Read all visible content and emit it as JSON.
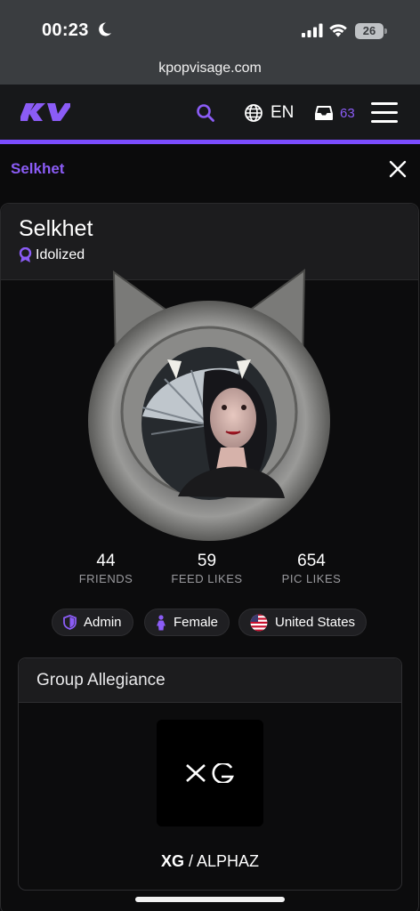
{
  "status_bar": {
    "time": "00:23",
    "battery": "26",
    "icons": [
      "moon-icon",
      "signal-icon",
      "wifi-icon",
      "battery-icon"
    ]
  },
  "browser": {
    "url": "kpopvisage.com"
  },
  "header": {
    "logo_icon": "kv-logo-icon",
    "language": "EN",
    "inbox_count": "63",
    "accent_color": "#7c4dff"
  },
  "page": {
    "title": "Selkhet"
  },
  "profile": {
    "name": "Selkhet",
    "rank": "Idolized",
    "stats": [
      {
        "value": "44",
        "label": "FRIENDS"
      },
      {
        "value": "59",
        "label": "FEED LIKES"
      },
      {
        "value": "654",
        "label": "PIC LIKES"
      }
    ],
    "badges": [
      {
        "label": "Admin",
        "icon": "shield-icon"
      },
      {
        "label": "Female",
        "icon": "female-icon"
      },
      {
        "label": "United States",
        "icon": "us-flag-icon"
      }
    ]
  },
  "group": {
    "title": "Group Allegiance",
    "logo_text": "XG",
    "name_bold": "XG",
    "separator": " / ",
    "fandom": "ALPHAZ"
  }
}
